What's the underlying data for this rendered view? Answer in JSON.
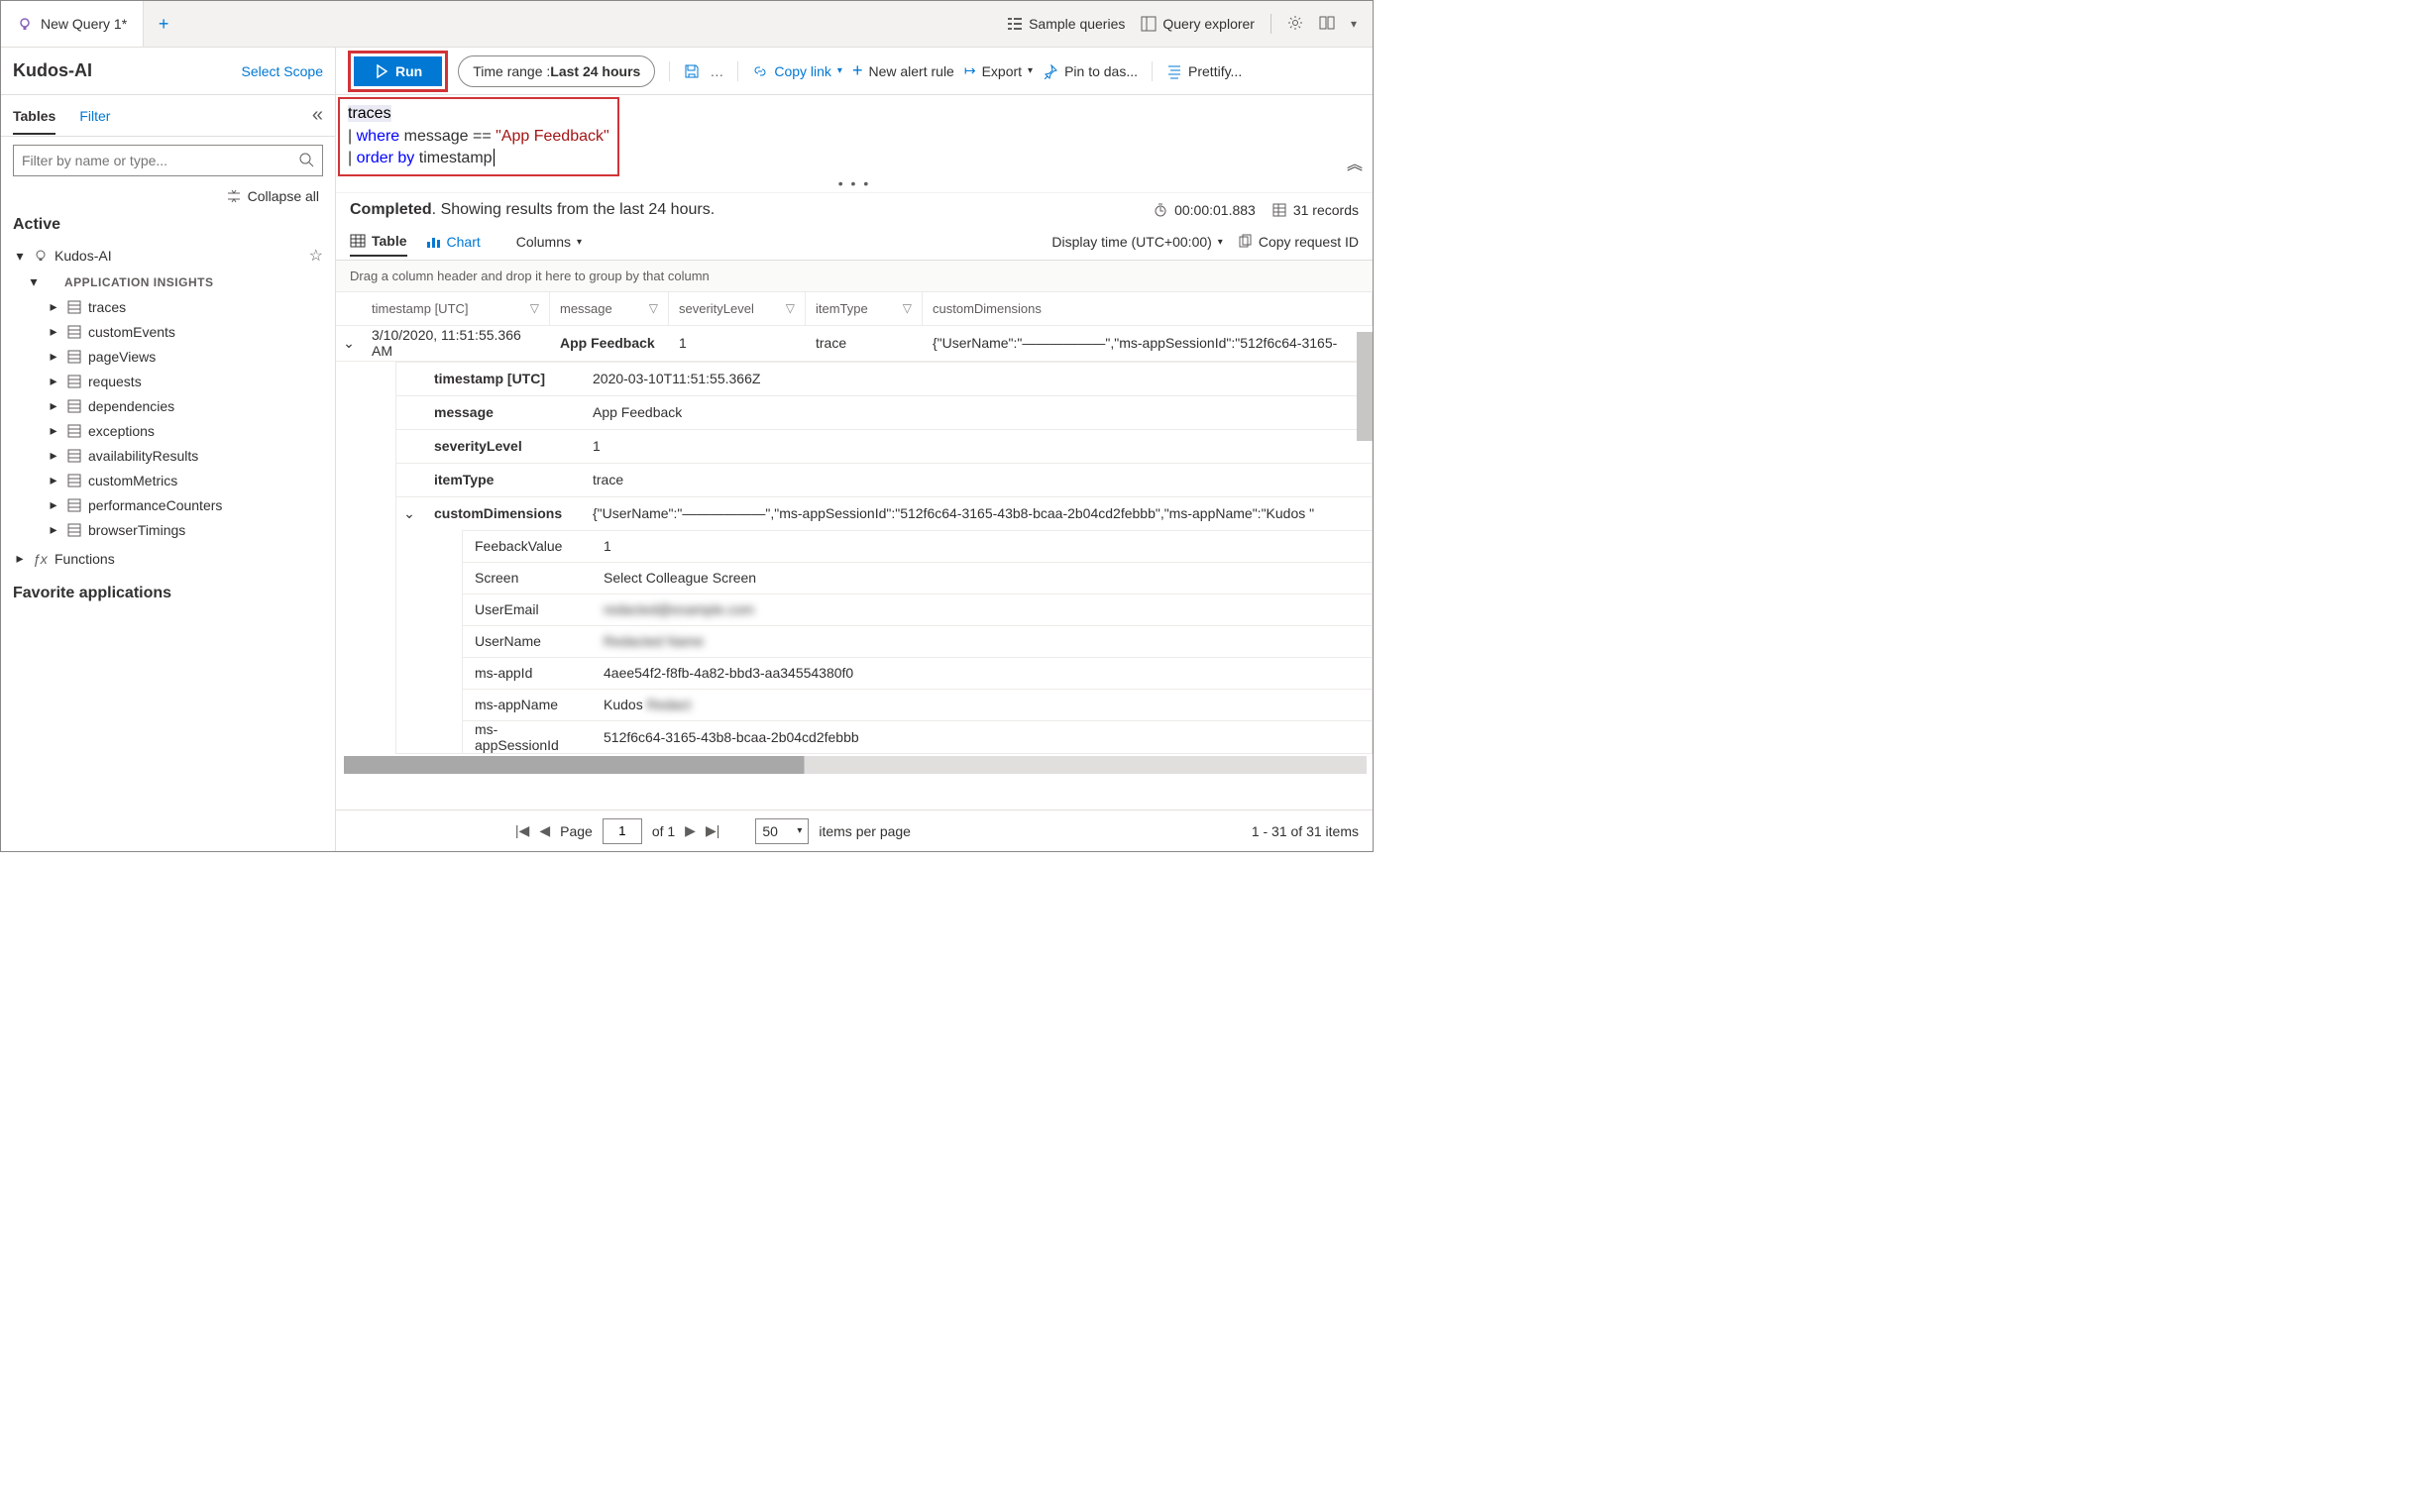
{
  "header": {
    "tab_label": "New Query 1*",
    "sample_queries": "Sample queries",
    "query_explorer": "Query explorer"
  },
  "sidebar": {
    "scope_name": "Kudos-AI",
    "select_scope": "Select Scope",
    "tab_tables": "Tables",
    "tab_filter": "Filter",
    "search_placeholder": "Filter by name or type...",
    "collapse_all": "Collapse all",
    "tree_active": "Active",
    "root": "Kudos-AI",
    "group": "APPLICATION INSIGHTS",
    "items": [
      "traces",
      "customEvents",
      "pageViews",
      "requests",
      "dependencies",
      "exceptions",
      "availabilityResults",
      "customMetrics",
      "performanceCounters",
      "browserTimings"
    ],
    "functions": "Functions",
    "favorites": "Favorite applications"
  },
  "toolbar": {
    "run": "Run",
    "time_range_label": "Time range : ",
    "time_range_value": "Last 24 hours",
    "copy_link": "Copy link",
    "new_alert": "New alert rule",
    "export": "Export",
    "pin": "Pin to das...",
    "prettify": "Prettify..."
  },
  "editor": {
    "line1_table": "traces",
    "line2_pipe": "| ",
    "line2_kw": "where",
    "line2_rest": " message == ",
    "line2_str": "\"App Feedback\"",
    "line3_pipe": "| ",
    "line3_kw": "order by",
    "line3_rest": " timestamp"
  },
  "status": {
    "completed_prefix": "Completed",
    "completed_suffix": ". Showing results from the last 24 hours.",
    "duration": "00:00:01.883",
    "records": "31 records"
  },
  "result_tabs": {
    "table": "Table",
    "chart": "Chart",
    "columns": "Columns",
    "display_time": "Display time (UTC+00:00)",
    "copy_request": "Copy request ID"
  },
  "group_hint": "Drag a column header and drop it here to group by that column",
  "columns": {
    "timestamp": "timestamp [UTC]",
    "message": "message",
    "severity": "severityLevel",
    "itemType": "itemType",
    "custom": "customDimensions"
  },
  "row": {
    "timestamp": "3/10/2020, 11:51:55.366 AM",
    "message": "App Feedback",
    "severity": "1",
    "itemType": "trace",
    "custom": "{\"UserName\":\"——————\",\"ms-appSessionId\":\"512f6c64-3165-"
  },
  "detail": {
    "timestamp_k": "timestamp [UTC]",
    "timestamp_v": "2020-03-10T11:51:55.366Z",
    "message_k": "message",
    "message_v": "App Feedback",
    "sev_k": "severityLevel",
    "sev_v": "1",
    "item_k": "itemType",
    "item_v": "trace",
    "cd_k": "customDimensions",
    "cd_v": "{\"UserName\":\"——————\",\"ms-appSessionId\":\"512f6c64-3165-43b8-bcaa-2b04cd2febbb\",\"ms-appName\":\"Kudos \""
  },
  "sub": [
    {
      "k": "FeebackValue",
      "v": "1"
    },
    {
      "k": "Screen",
      "v": "Select Colleague Screen"
    },
    {
      "k": "UserEmail",
      "v": "redacted@example.com",
      "blur": true
    },
    {
      "k": "UserName",
      "v": "Redacted Name",
      "blur": true
    },
    {
      "k": "ms-appId",
      "v": "4aee54f2-f8fb-4a82-bbd3-aa34554380f0"
    },
    {
      "k": "ms-appName",
      "v": "Kudos      ",
      "blurTail": true
    },
    {
      "k": "ms-appSessionId",
      "v": "512f6c64-3165-43b8-bcaa-2b04cd2febbb"
    }
  ],
  "pager": {
    "page_label": "Page",
    "page": "1",
    "of": "of 1",
    "size": "50",
    "ipp": "items per page",
    "summary": "1 - 31 of 31 items"
  }
}
